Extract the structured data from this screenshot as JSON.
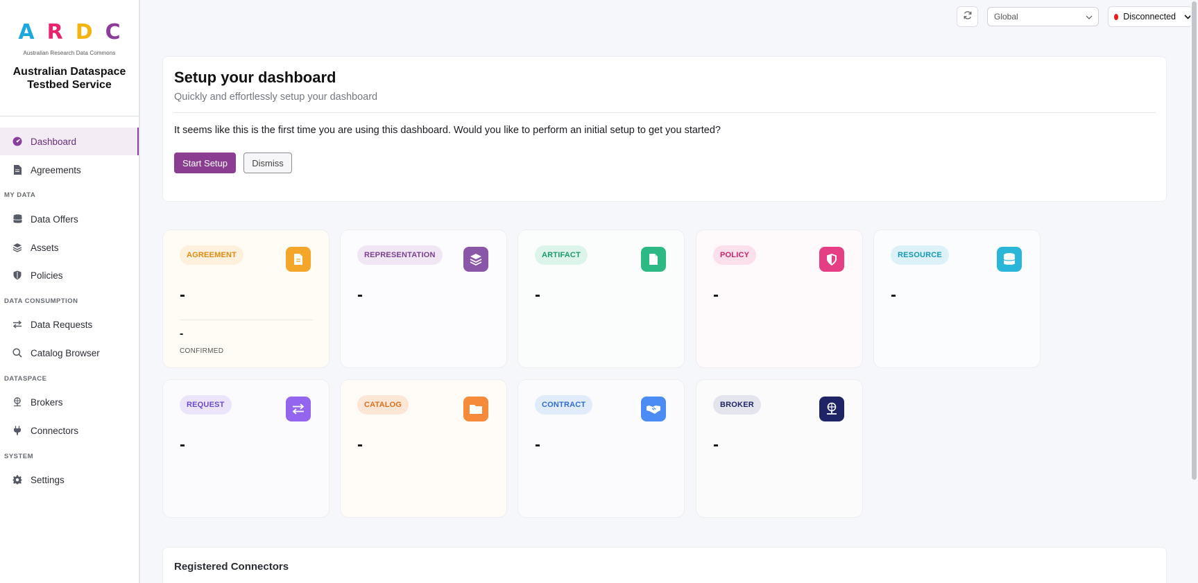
{
  "brand": {
    "logo_letters": [
      "A",
      "R",
      "D",
      "C"
    ],
    "logo_colors": [
      "#1fa8e0",
      "#e8246f",
      "#f5b30f",
      "#8b3d99"
    ],
    "logo_subtitle": "Australian Research Data Commons",
    "title_line1": "Australian Dataspace",
    "title_line2": "Testbed Service"
  },
  "sidebar": {
    "items": [
      {
        "label": "Dashboard",
        "icon": "gauge-icon",
        "active": true
      },
      {
        "label": "Agreements",
        "icon": "document-icon"
      }
    ],
    "sections": [
      {
        "title": "MY DATA",
        "items": [
          {
            "label": "Data Offers",
            "icon": "database-icon"
          },
          {
            "label": "Assets",
            "icon": "layers-icon"
          },
          {
            "label": "Policies",
            "icon": "shield-icon"
          }
        ]
      },
      {
        "title": "DATA CONSUMPTION",
        "items": [
          {
            "label": "Data Requests",
            "icon": "arrows-exchange-icon"
          },
          {
            "label": "Catalog Browser",
            "icon": "search-icon"
          }
        ]
      },
      {
        "title": "DATASPACE",
        "items": [
          {
            "label": "Brokers",
            "icon": "network-icon"
          },
          {
            "label": "Connectors",
            "icon": "plug-icon"
          }
        ]
      },
      {
        "title": "SYSTEM",
        "items": [
          {
            "label": "Settings",
            "icon": "gear-icon"
          }
        ]
      }
    ]
  },
  "topbar": {
    "scope_selected": "Global",
    "status_label": "Disconnected",
    "status_color": "#e81c1c"
  },
  "setup": {
    "title": "Setup your dashboard",
    "subtitle": "Quickly and effortlessly setup your dashboard",
    "message": "It seems like this is the first time you are using this dashboard. Would you like to perform an initial setup to get you started?",
    "start_label": "Start Setup",
    "dismiss_label": "Dismiss"
  },
  "stats": [
    {
      "label": "AGREEMENT",
      "value": "-",
      "sub_value": "-",
      "sub_label": "CONFIRMED",
      "accent": "#f4a62a",
      "badge_text": "#e08a12",
      "badge_bg": "#fdf0dc",
      "card_bg": "#fffcf5",
      "icon": "document-icon"
    },
    {
      "label": "REPRESENTATION",
      "value": "-",
      "accent": "#8a56a8",
      "badge_text": "#7a3f93",
      "badge_bg": "#f1e7f4",
      "card_bg": "#fcfbfd",
      "icon": "layers-icon"
    },
    {
      "label": "ARTIFACT",
      "value": "-",
      "accent": "#2cb984",
      "badge_text": "#1a9a69",
      "badge_bg": "#ddf4ea",
      "card_bg": "#fbfcfc",
      "icon": "file-icon"
    },
    {
      "label": "POLICY",
      "value": "-",
      "accent": "#e63e84",
      "badge_text": "#c7246b",
      "badge_bg": "#fbe0ec",
      "card_bg": "#fefafc",
      "icon": "shield-icon"
    },
    {
      "label": "RESOURCE",
      "value": "-",
      "accent": "#2ab6d8",
      "badge_text": "#1597b8",
      "badge_bg": "#dcf2f8",
      "card_bg": "#fafcfd",
      "icon": "database-icon"
    },
    {
      "label": "REQUEST",
      "value": "-",
      "accent": "#9466f0",
      "badge_text": "#6b4bd0",
      "badge_bg": "#ebe4fb",
      "card_bg": "#fbfbfd",
      "icon": "arrows-exchange-icon"
    },
    {
      "label": "CATALOG",
      "value": "-",
      "accent": "#f58a3a",
      "badge_text": "#e0701c",
      "badge_bg": "#fde6d6",
      "card_bg": "#fffbf7",
      "icon": "folder-icon"
    },
    {
      "label": "CONTRACT",
      "value": "-",
      "accent": "#4a8cf3",
      "badge_text": "#2f6ed0",
      "badge_bg": "#e0ebfc",
      "card_bg": "#fbfbfd",
      "icon": "handshake-icon"
    },
    {
      "label": "BROKER",
      "value": "-",
      "accent": "#1f2466",
      "badge_text": "#1f2466",
      "badge_bg": "#e4e4ec",
      "card_bg": "#fbfbfc",
      "icon": "network-icon"
    }
  ],
  "connectors": {
    "title": "Registered Connectors"
  }
}
